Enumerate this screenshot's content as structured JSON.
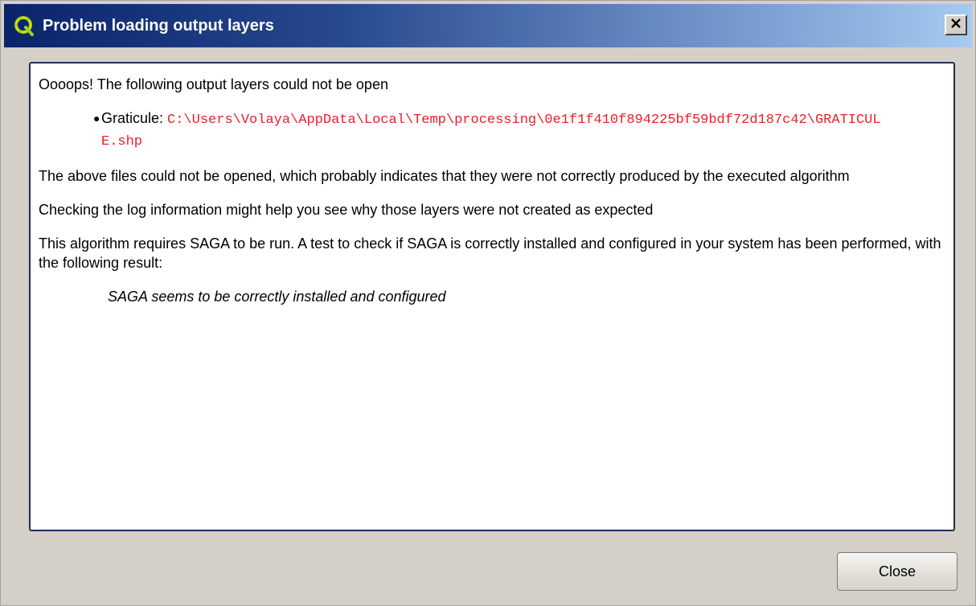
{
  "window": {
    "title": "Problem loading output layers",
    "app_icon": "qgis-icon",
    "close_icon": "close-icon"
  },
  "message": {
    "intro": "Oooops! The following output layers could not be open",
    "layers": [
      {
        "name": "Graticule: ",
        "path": "C:\\Users\\Volaya\\AppData\\Local\\Temp\\processing\\0e1f1f410f894225bf59bdf72d187c42\\GRATICULE.shp"
      }
    ],
    "explanation": "The above files could not be opened, which probably indicates that they were not correctly produced by the executed algorithm",
    "log_hint": "Checking the log information might help you see why those layers were not created as expected",
    "saga_check": "This algorithm requires SAGA to be run. A test to check if SAGA is correctly installed and configured in your system has been performed, with the following result:",
    "saga_result": "SAGA seems to be correctly installed and configured"
  },
  "buttons": {
    "close_label": "Close"
  },
  "colors": {
    "path_text": "#e8202a",
    "title_gradient_start": "#0a246a",
    "title_gradient_end": "#a6caf0"
  }
}
